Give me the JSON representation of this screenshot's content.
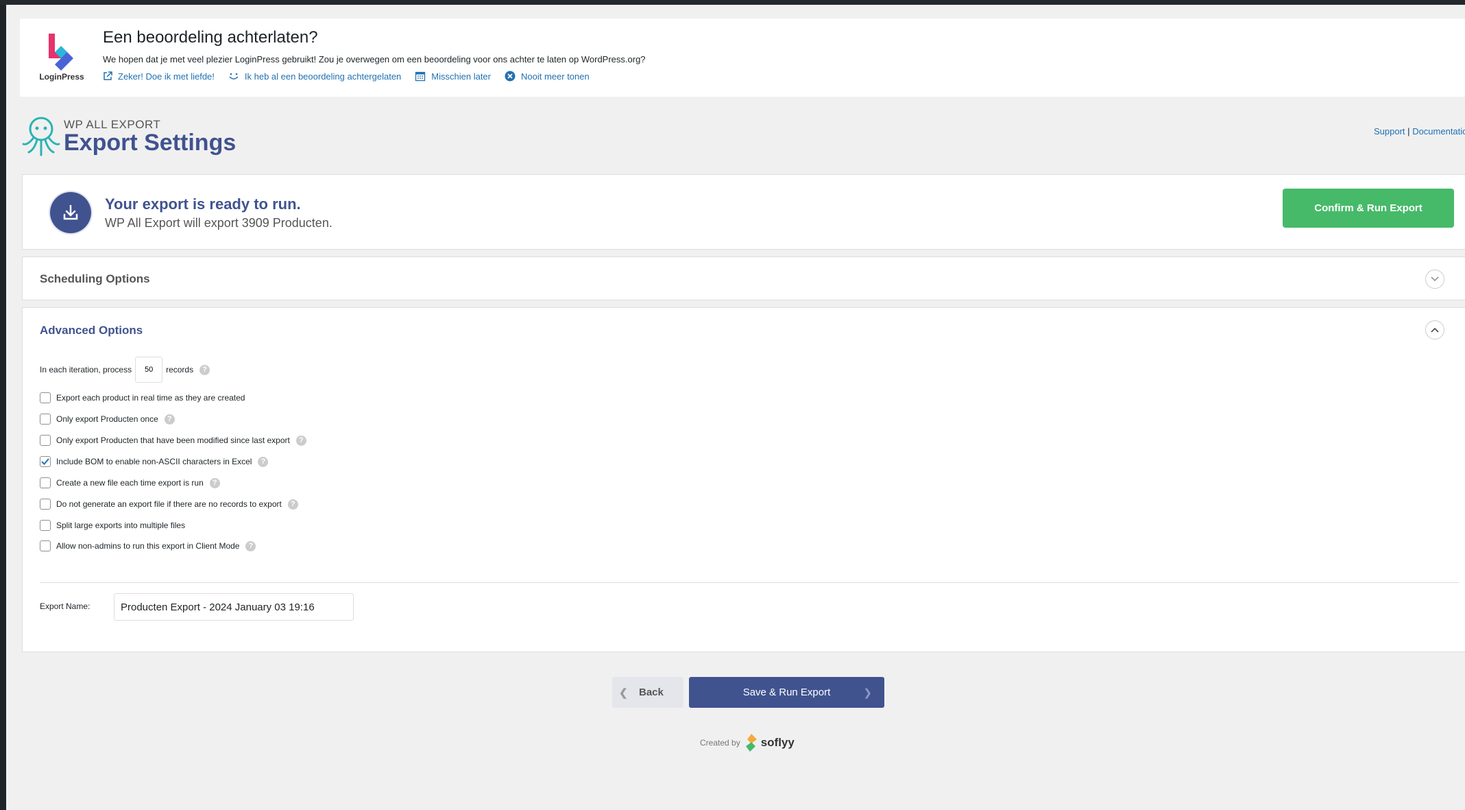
{
  "notice": {
    "brand_name": "LoginPress",
    "title": "Een beoordeling achterlaten?",
    "message": "We hopen dat je met veel plezier LoginPress gebruikt! Zou je overwegen om een beoordeling voor ons achter te laten op WordPress.org?",
    "links": [
      {
        "label": "Zeker! Doe ik met liefde!",
        "icon": "external-link-icon"
      },
      {
        "label": "Ik heb al een beoordeling achtergelaten",
        "icon": "smile-icon"
      },
      {
        "label": "Misschien later",
        "icon": "calendar-icon"
      },
      {
        "label": "Nooit meer tonen",
        "icon": "close-circle-icon"
      }
    ]
  },
  "header": {
    "product": "WP ALL EXPORT",
    "title": "Export Settings",
    "support": "Support",
    "separator": "|",
    "documentation": "Documentatio"
  },
  "ready": {
    "title": "Your export is ready to run.",
    "subtitle": "WP All Export will export 3909 Producten.",
    "confirm_label": "Confirm & Run Export"
  },
  "scheduling": {
    "title": "Scheduling Options"
  },
  "advanced": {
    "title": "Advanced Options",
    "iteration_prefix": "In each iteration, process",
    "iteration_value": "50",
    "iteration_suffix": "records",
    "options": [
      {
        "label": "Export each product in real time as they are created",
        "checked": false,
        "help": false
      },
      {
        "label": "Only export Producten once",
        "checked": false,
        "help": true
      },
      {
        "label": "Only export Producten that have been modified since last export",
        "checked": false,
        "help": true
      },
      {
        "label": "Include BOM to enable non-ASCII characters in Excel",
        "checked": true,
        "help": true
      },
      {
        "label": "Create a new file each time export is run",
        "checked": false,
        "help": true
      },
      {
        "label": "Do not generate an export file if there are no records to export",
        "checked": false,
        "help": true
      },
      {
        "label": "Split large exports into multiple files",
        "checked": false,
        "help": false
      },
      {
        "label": "Allow non-admins to run this export in Client Mode",
        "checked": false,
        "help": true
      }
    ],
    "export_name_label": "Export Name:",
    "export_name_value": "Producten Export - 2024 January 03 19:16"
  },
  "footer": {
    "back_label": "Back",
    "save_label": "Save & Run Export",
    "created_by": "Created by",
    "company": "soflyy"
  },
  "colors": {
    "accent": "#40538f",
    "success": "#46ba69",
    "link": "#2271b1"
  }
}
